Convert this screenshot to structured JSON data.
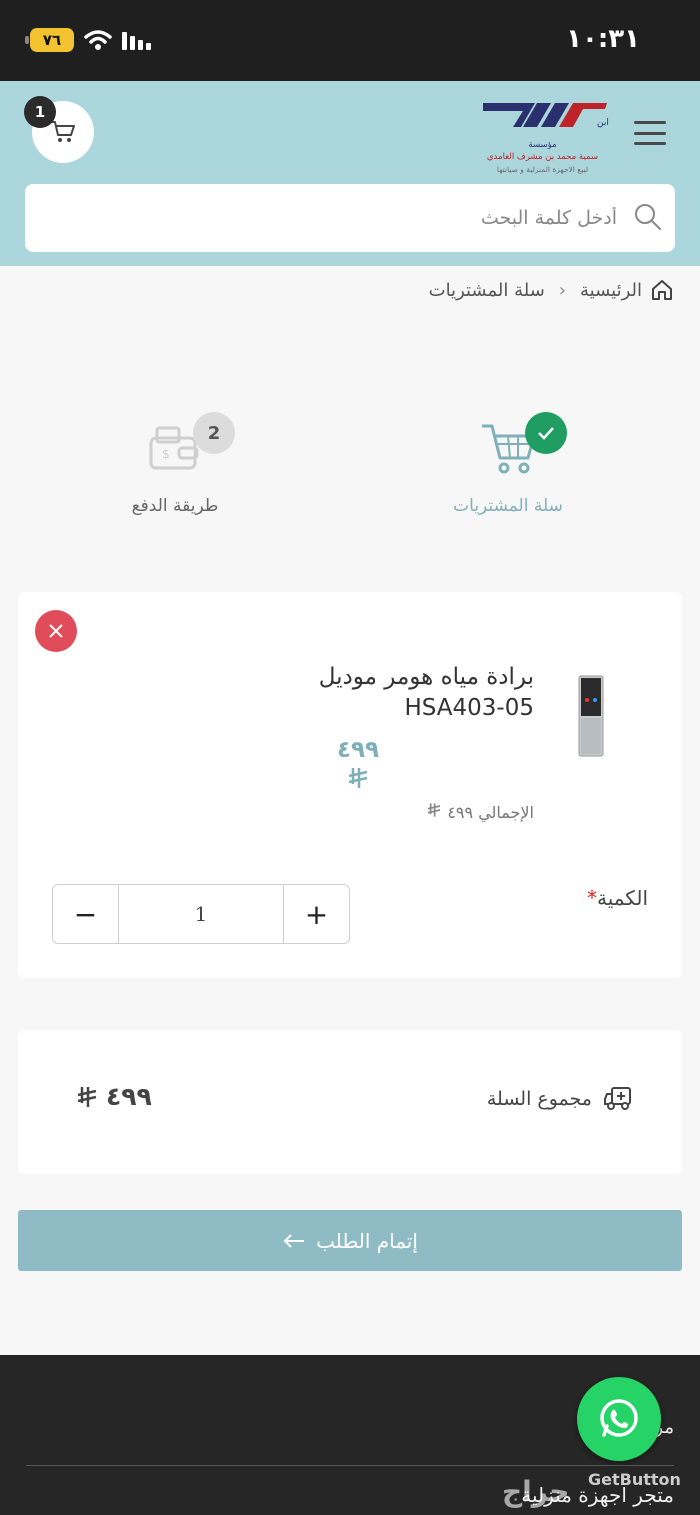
{
  "status_bar": {
    "time": "١٠:٣١",
    "battery": "٧٦"
  },
  "header": {
    "cart_count": "1",
    "logo": {
      "line1": "مؤسسة",
      "line2": "سمية محمد بن مشرف الغامدي",
      "line3": "لبيع الاجهزة المنزلية و صيانتها"
    }
  },
  "search": {
    "placeholder": "أدخل كلمة البحث"
  },
  "breadcrumb": {
    "home": "الرئيسية",
    "current": "سلة المشتريات"
  },
  "steps": [
    {
      "label": "سلة المشتريات",
      "badge": "✓"
    },
    {
      "label": "طريقة الدفع",
      "badge": "2"
    }
  ],
  "product": {
    "name": "برادة مياه هومر موديل HSA403-05",
    "price": "٤٩٩",
    "total_label": "الإجمالي ٤٩٩",
    "qty_label": "الكمية",
    "qty_required": "*",
    "qty_value": "1",
    "minus": "−",
    "plus": "+"
  },
  "cart_total": {
    "label": "مجموع السلة",
    "value": "٤٩٩"
  },
  "checkout": {
    "label": "إتمام الطلب"
  },
  "footer": {
    "text1": "مر",
    "text2": "متجر اجهزة منزلية"
  },
  "getbutton": "GetButton",
  "watermark": "حراج",
  "colors": {
    "accent": "#aad6dc",
    "button": "#8fbcc4",
    "success": "#1f9d63",
    "danger": "#e14c5b",
    "whatsapp": "#25d366"
  }
}
